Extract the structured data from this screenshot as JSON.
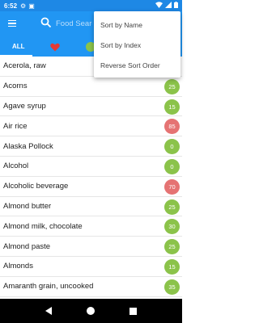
{
  "status_bar": {
    "time": "6:52"
  },
  "toolbar": {
    "search_placeholder": "Food Search"
  },
  "tabs": {
    "all_label": "ALL"
  },
  "foods": [
    {
      "name": "Acerola, raw",
      "index": "",
      "color": ""
    },
    {
      "name": "Acorns",
      "index": "25",
      "color": "#8bc34a"
    },
    {
      "name": "Agave syrup",
      "index": "15",
      "color": "#8bc34a"
    },
    {
      "name": "Air rice",
      "index": "85",
      "color": "#e57373"
    },
    {
      "name": "Alaska Pollock",
      "index": "0",
      "color": "#8bc34a"
    },
    {
      "name": "Alcohol",
      "index": "0",
      "color": "#8bc34a"
    },
    {
      "name": "Alcoholic beverage",
      "index": "70",
      "color": "#e57373"
    },
    {
      "name": "Almond butter",
      "index": "25",
      "color": "#8bc34a"
    },
    {
      "name": "Almond milk, chocolate",
      "index": "30",
      "color": "#8bc34a"
    },
    {
      "name": "Almond paste",
      "index": "25",
      "color": "#8bc34a"
    },
    {
      "name": "Almonds",
      "index": "15",
      "color": "#8bc34a"
    },
    {
      "name": "Amaranth grain, uncooked",
      "index": "35",
      "color": "#8bc34a"
    },
    {
      "name": "",
      "index": "",
      "color": "#e57373"
    }
  ],
  "sort_menu": {
    "by_name": "Sort by Name",
    "by_index": "Sort by Index",
    "reverse": "Reverse Sort Order"
  },
  "colors": {
    "primary": "#2196f3",
    "status_bar": "#1e88e5",
    "low": "#8bc34a",
    "high": "#e57373"
  }
}
